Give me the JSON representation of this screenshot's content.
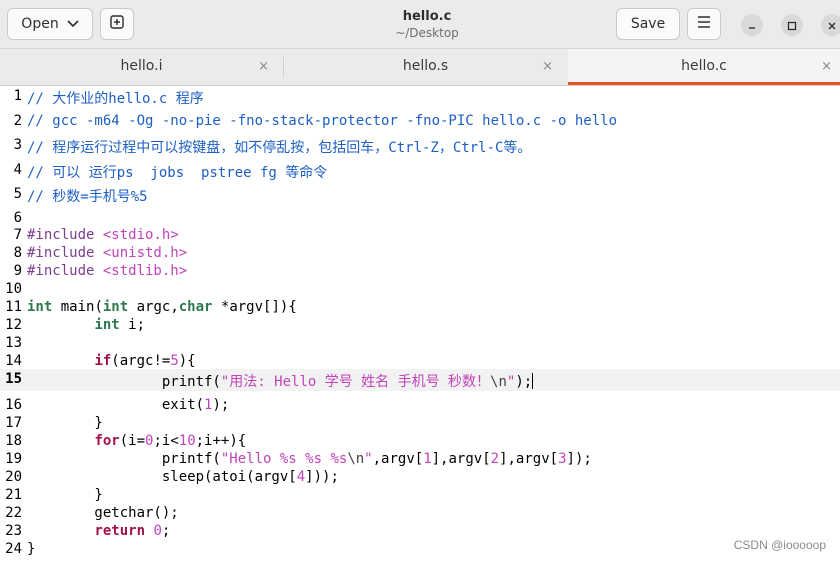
{
  "header": {
    "open_label": "Open",
    "save_label": "Save",
    "title": "hello.c",
    "subtitle": "~/Desktop"
  },
  "tabs": [
    {
      "label": "hello.i",
      "close": "×",
      "active": false
    },
    {
      "label": "hello.s",
      "close": "×",
      "active": false
    },
    {
      "label": "hello.c",
      "close": "×",
      "active": true
    }
  ],
  "icons": {
    "open_chevron": "chevron-down-icon",
    "new_tab": "new-tab-icon",
    "menu": "hamburger-icon",
    "minimize": "minimize-icon",
    "maximize": "maximize-icon",
    "close": "close-icon"
  },
  "editor": {
    "current_line": 15,
    "lines": [
      {
        "n": "1",
        "tokens": [
          [
            "cm",
            "// 大作业的hello.c 程序"
          ]
        ]
      },
      {
        "n": "2",
        "tokens": [
          [
            "cm",
            "// gcc -m64 -Og -no-pie -fno-stack-protector -fno-PIC hello.c -o hello"
          ]
        ]
      },
      {
        "n": "3",
        "tokens": [
          [
            "cm",
            "// 程序运行过程中可以按键盘，如不停乱按，包括回车，Ctrl-Z，Ctrl-C等。"
          ]
        ]
      },
      {
        "n": "4",
        "tokens": [
          [
            "cm",
            "// 可以 运行ps  jobs  pstree fg 等命令"
          ]
        ]
      },
      {
        "n": "5",
        "tokens": [
          [
            "cm",
            "// 秒数=手机号%5"
          ]
        ]
      },
      {
        "n": "6",
        "tokens": []
      },
      {
        "n": "7",
        "tokens": [
          [
            "pp",
            "#include "
          ],
          [
            "str",
            "<stdio.h>"
          ]
        ]
      },
      {
        "n": "8",
        "tokens": [
          [
            "pp",
            "#include "
          ],
          [
            "str",
            "<unistd.h>"
          ]
        ]
      },
      {
        "n": "9",
        "tokens": [
          [
            "pp",
            "#include "
          ],
          [
            "str",
            "<stdlib.h>"
          ]
        ]
      },
      {
        "n": "10",
        "tokens": []
      },
      {
        "n": "11",
        "tokens": [
          [
            "ty",
            "int"
          ],
          [
            "",
            " main("
          ],
          [
            "ty",
            "int"
          ],
          [
            "",
            " argc,"
          ],
          [
            "ty",
            "char"
          ],
          [
            "",
            " *argv[]){"
          ]
        ]
      },
      {
        "n": "12",
        "tokens": [
          [
            "",
            "        "
          ],
          [
            "ty",
            "int"
          ],
          [
            "",
            " i;"
          ]
        ]
      },
      {
        "n": "13",
        "tokens": []
      },
      {
        "n": "14",
        "tokens": [
          [
            "",
            "        "
          ],
          [
            "kw",
            "if"
          ],
          [
            "",
            "(argc!="
          ],
          [
            "num",
            "5"
          ],
          [
            "",
            "){"
          ]
        ]
      },
      {
        "n": "15",
        "tokens": [
          [
            "",
            "                printf("
          ],
          [
            "str",
            "\"用法: Hello 学号 姓名 手机号 秒数！"
          ],
          [
            "esc",
            "\\n"
          ],
          [
            "str",
            "\""
          ],
          [
            "",
            ");"
          ]
        ]
      },
      {
        "n": "16",
        "tokens": [
          [
            "",
            "                exit("
          ],
          [
            "num",
            "1"
          ],
          [
            "",
            ");"
          ]
        ]
      },
      {
        "n": "17",
        "tokens": [
          [
            "",
            "        }"
          ]
        ]
      },
      {
        "n": "18",
        "tokens": [
          [
            "",
            "        "
          ],
          [
            "kw",
            "for"
          ],
          [
            "",
            "(i="
          ],
          [
            "num",
            "0"
          ],
          [
            "",
            ";i<"
          ],
          [
            "num",
            "10"
          ],
          [
            "",
            ";i++){"
          ]
        ]
      },
      {
        "n": "19",
        "tokens": [
          [
            "",
            "                printf("
          ],
          [
            "str",
            "\"Hello %s %s %s"
          ],
          [
            "esc",
            "\\n"
          ],
          [
            "str",
            "\""
          ],
          [
            "",
            ",argv["
          ],
          [
            "num",
            "1"
          ],
          [
            "",
            "],argv["
          ],
          [
            "num",
            "2"
          ],
          [
            "",
            "],argv["
          ],
          [
            "num",
            "3"
          ],
          [
            "",
            "]);"
          ]
        ]
      },
      {
        "n": "20",
        "tokens": [
          [
            "",
            "                sleep(atoi(argv["
          ],
          [
            "num",
            "4"
          ],
          [
            "",
            "]));"
          ]
        ]
      },
      {
        "n": "21",
        "tokens": [
          [
            "",
            "        }"
          ]
        ]
      },
      {
        "n": "22",
        "tokens": [
          [
            "",
            "        getchar();"
          ]
        ]
      },
      {
        "n": "23",
        "tokens": [
          [
            "",
            "        "
          ],
          [
            "kw",
            "return"
          ],
          [
            "",
            " "
          ],
          [
            "num",
            "0"
          ],
          [
            "",
            ";"
          ]
        ]
      },
      {
        "n": "24",
        "tokens": [
          [
            "",
            "}"
          ]
        ]
      }
    ]
  },
  "watermark": "CSDN @iooooop"
}
